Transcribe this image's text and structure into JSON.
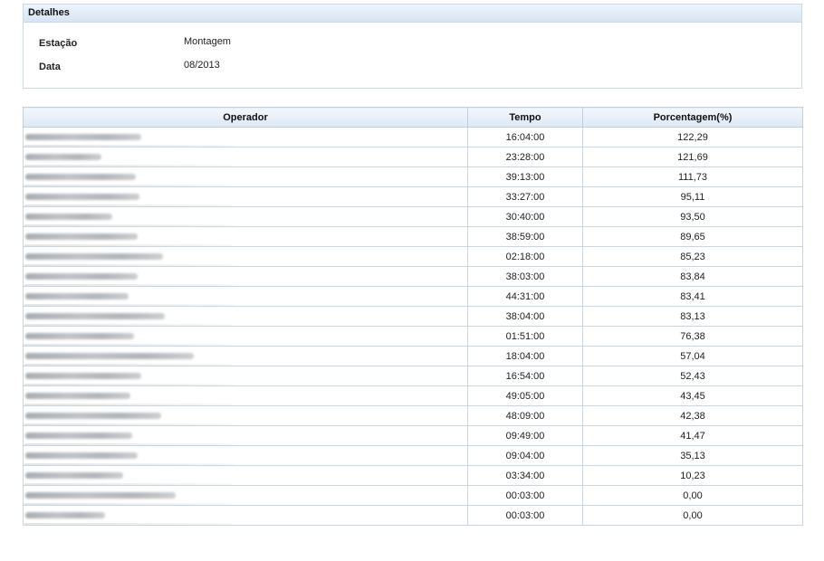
{
  "details": {
    "title": "Detalhes",
    "fields": [
      {
        "label": "Estação",
        "value": "Montagem"
      },
      {
        "label": "Data",
        "value": "08/2013"
      }
    ]
  },
  "table": {
    "headers": [
      "Operador",
      "Tempo",
      "Porcentagem(%)"
    ],
    "rows": [
      {
        "tempo": "16:04:00",
        "pct": "122,29"
      },
      {
        "tempo": "23:28:00",
        "pct": "121,69"
      },
      {
        "tempo": "39:13:00",
        "pct": "111,73"
      },
      {
        "tempo": "33:27:00",
        "pct": "95,11"
      },
      {
        "tempo": "30:40:00",
        "pct": "93,50"
      },
      {
        "tempo": "38:59:00",
        "pct": "89,65"
      },
      {
        "tempo": "02:18:00",
        "pct": "85,23"
      },
      {
        "tempo": "38:03:00",
        "pct": "83,84"
      },
      {
        "tempo": "44:31:00",
        "pct": "83,41"
      },
      {
        "tempo": "38:04:00",
        "pct": "83,13"
      },
      {
        "tempo": "01:51:00",
        "pct": "76,38"
      },
      {
        "tempo": "18:04:00",
        "pct": "57,04"
      },
      {
        "tempo": "16:54:00",
        "pct": "52,43"
      },
      {
        "tempo": "49:05:00",
        "pct": "43,45"
      },
      {
        "tempo": "48:09:00",
        "pct": "42,38"
      },
      {
        "tempo": "09:49:00",
        "pct": "41,47"
      },
      {
        "tempo": "09:04:00",
        "pct": "35,13"
      },
      {
        "tempo": "03:34:00",
        "pct": "10,23"
      },
      {
        "tempo": "00:03:00",
        "pct": "0,00"
      },
      {
        "tempo": "00:03:00",
        "pct": "0,00"
      }
    ]
  }
}
